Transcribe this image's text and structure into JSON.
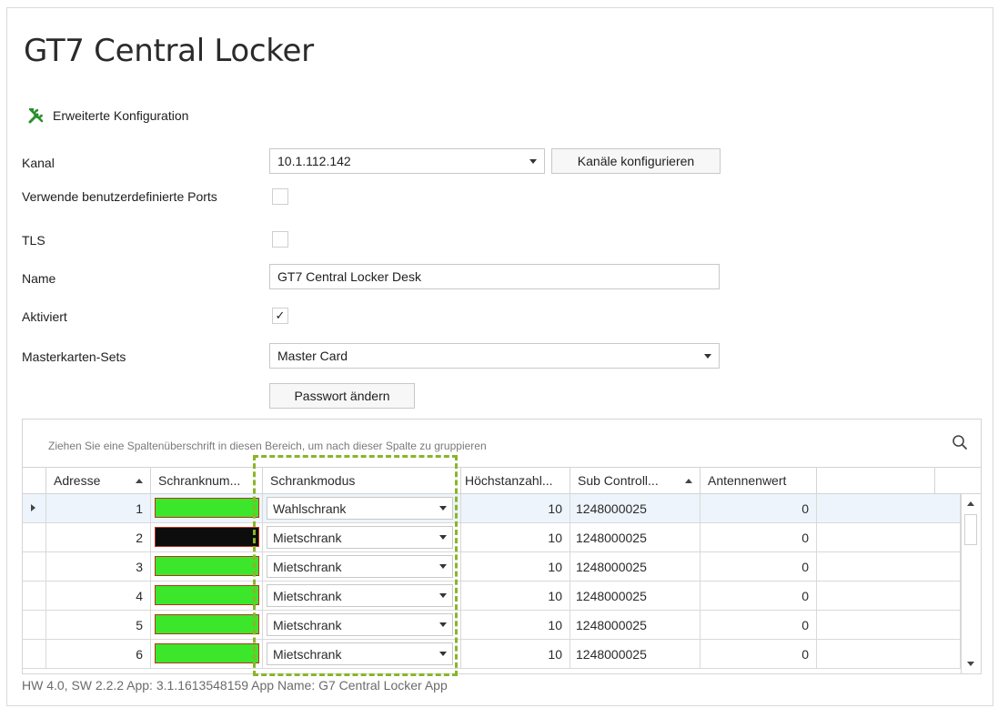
{
  "window": {
    "title": "GT7 Central Locker"
  },
  "advanced": {
    "label": "Erweiterte Konfiguration",
    "icon": "tools-icon"
  },
  "form": {
    "channel": {
      "label": "Kanal",
      "value": "10.1.112.142",
      "configure_button": "Kanäle konfigurieren"
    },
    "custom_ports": {
      "label": "Verwende benutzerdefinierte Ports",
      "checked": false
    },
    "tls": {
      "label": "TLS",
      "checked": false
    },
    "name": {
      "label": "Name",
      "value": "GT7 Central Locker Desk"
    },
    "activated": {
      "label": "Aktiviert",
      "checked": true,
      "mark": "✓"
    },
    "master_sets": {
      "label": "Masterkarten-Sets",
      "value": "Master Card"
    },
    "change_password_button": "Passwort ändern"
  },
  "grid": {
    "group_hint": "Ziehen Sie eine Spaltenüberschrift in diesen Bereich, um nach dieser Spalte zu gruppieren",
    "columns": [
      "Adresse",
      "Schranknum...",
      "Schrankmodus",
      "Höchstanzahl...",
      "Sub Controll...",
      "Antennenwert"
    ],
    "rows": [
      {
        "address": "1",
        "color": "#3ce62a",
        "mode": "Wahlschrank",
        "max": "10",
        "sub": "1248000025",
        "antenna": "0"
      },
      {
        "address": "2",
        "color": "#0d0d0d",
        "mode": "Mietschrank",
        "max": "10",
        "sub": "1248000025",
        "antenna": "0"
      },
      {
        "address": "3",
        "color": "#3ce62a",
        "mode": "Mietschrank",
        "max": "10",
        "sub": "1248000025",
        "antenna": "0"
      },
      {
        "address": "4",
        "color": "#3ce62a",
        "mode": "Mietschrank",
        "max": "10",
        "sub": "1248000025",
        "antenna": "0"
      },
      {
        "address": "5",
        "color": "#3ce62a",
        "mode": "Mietschrank",
        "max": "10",
        "sub": "1248000025",
        "antenna": "0"
      },
      {
        "address": "6",
        "color": "#3ce62a",
        "mode": "Mietschrank",
        "max": "10",
        "sub": "1248000025",
        "antenna": "0"
      }
    ]
  },
  "footer": "HW 4.0, SW 2.2.2 App: 3.1.1613548159 App Name: G7 Central Locker App",
  "colors": {
    "highlight": "#8ab52a",
    "accent_green": "#2a8f2a"
  }
}
